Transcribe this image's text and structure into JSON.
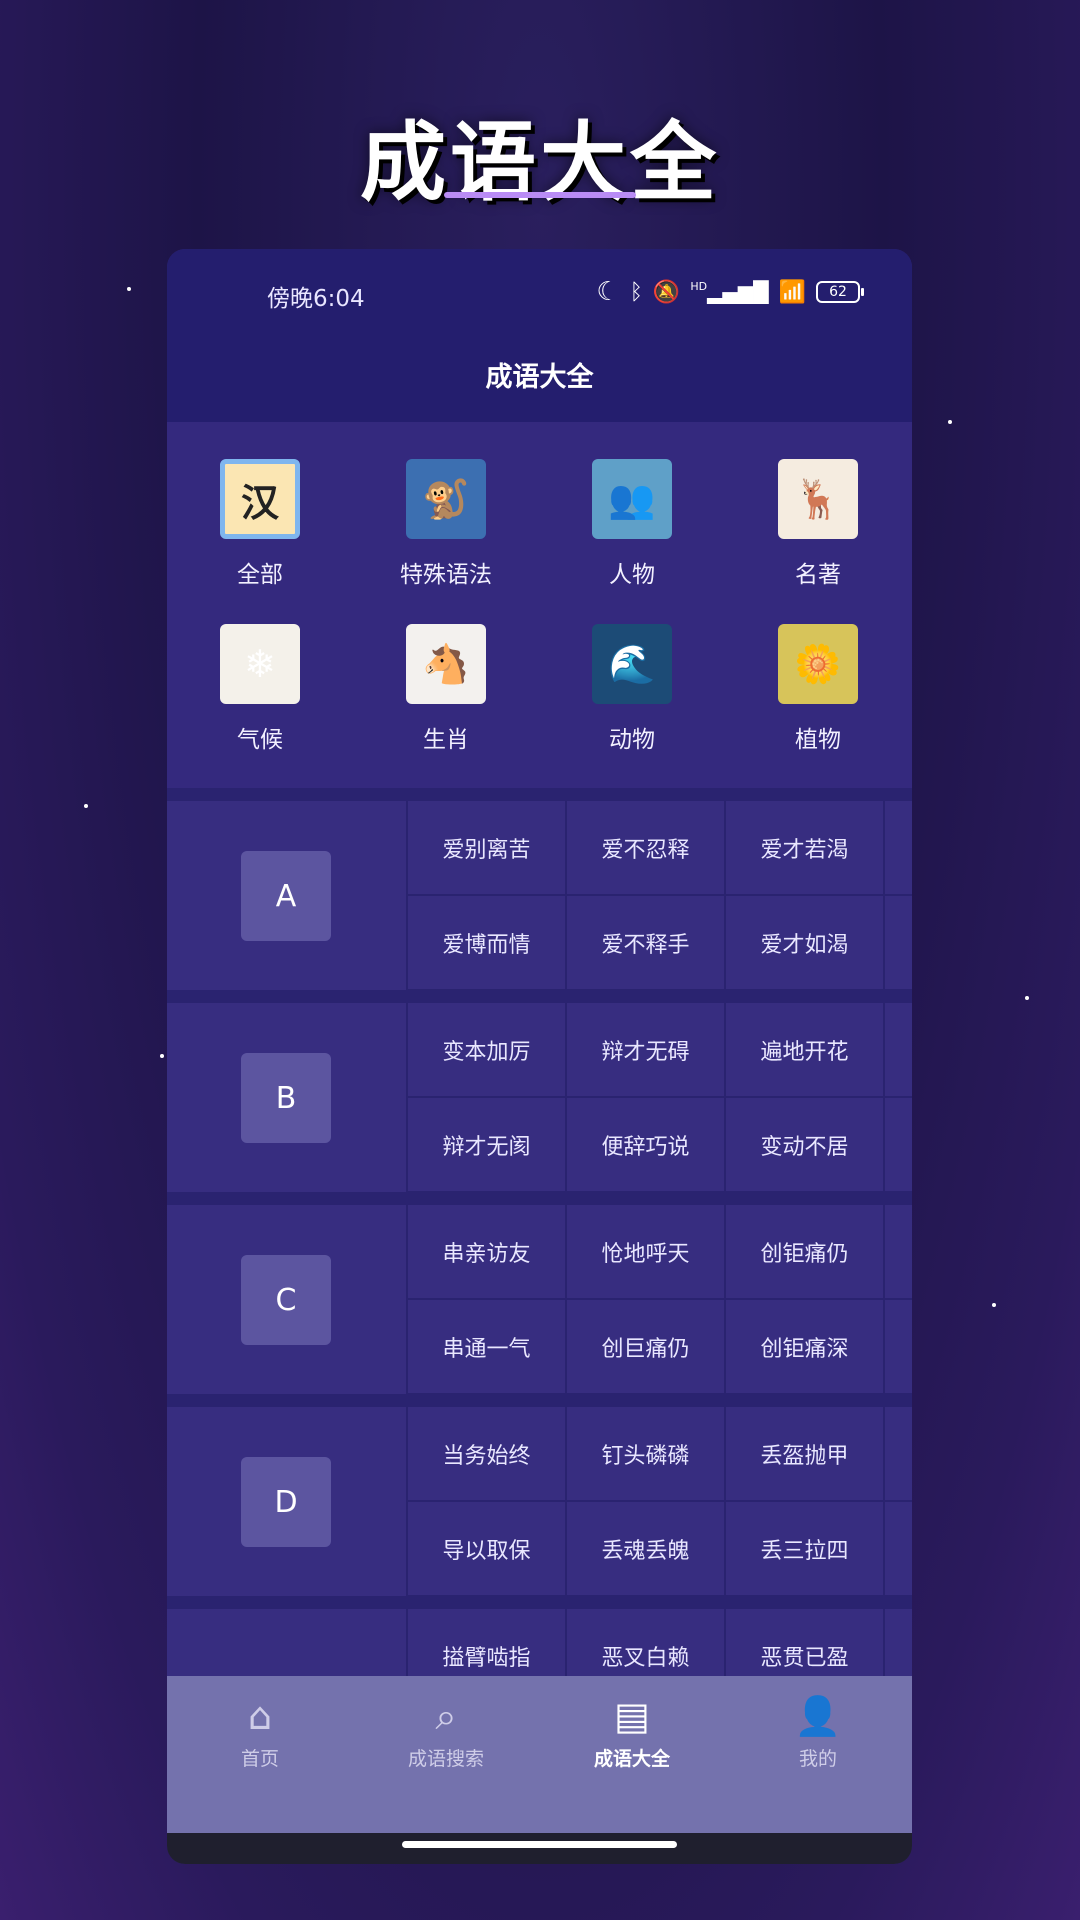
{
  "promo": {
    "title": "成语大全"
  },
  "status": {
    "time": "傍晚6:04",
    "battery": "62",
    "hd_label": "HD"
  },
  "app": {
    "title": "成语大全"
  },
  "categories": [
    {
      "label": "全部",
      "icon": "han-character-icon",
      "glyph": "汉",
      "bg": "#fbe6b3"
    },
    {
      "label": "特殊语法",
      "icon": "illustration-icon",
      "glyph": "🐒",
      "bg": "#3c6fb1"
    },
    {
      "label": "人物",
      "icon": "illustration-icon",
      "glyph": "👥",
      "bg": "#5fa0c8"
    },
    {
      "label": "名著",
      "icon": "illustration-icon",
      "glyph": "🦌",
      "bg": "#f5ece0"
    },
    {
      "label": "气候",
      "icon": "illustration-icon",
      "glyph": "❄",
      "bg": "#f4f1ea"
    },
    {
      "label": "生肖",
      "icon": "illustration-icon",
      "glyph": "🐴",
      "bg": "#f3f1ee"
    },
    {
      "label": "动物",
      "icon": "illustration-icon",
      "glyph": "🌊",
      "bg": "#1c4b76"
    },
    {
      "label": "植物",
      "icon": "illustration-icon",
      "glyph": "🌼",
      "bg": "#d7c45a"
    }
  ],
  "groups": [
    {
      "letter": "A",
      "idioms": [
        "爱别离苦",
        "爱不忍释",
        "爱才若渴",
        "爱博而情",
        "爱不释手",
        "爱才如渴"
      ]
    },
    {
      "letter": "B",
      "idioms": [
        "变本加厉",
        "辩才无碍",
        "遍地开花",
        "辩才无阂",
        "便辞巧说",
        "变动不居"
      ]
    },
    {
      "letter": "C",
      "idioms": [
        "串亲访友",
        "怆地呼天",
        "创钜痛仍",
        "串通一气",
        "创巨痛仍",
        "创钜痛深"
      ]
    },
    {
      "letter": "D",
      "idioms": [
        "当务始终",
        "钉头磷磷",
        "丢盔抛甲",
        "导以取保",
        "丢魂丢魄",
        "丢三拉四"
      ]
    },
    {
      "letter": "",
      "idioms": [
        "搤臂啮指",
        "恶叉白赖",
        "恶贯已盈"
      ]
    }
  ],
  "nav": [
    {
      "label": "首页",
      "icon": "home-icon",
      "glyph": "⌂"
    },
    {
      "label": "成语搜索",
      "icon": "search-icon",
      "glyph": "⌕"
    },
    {
      "label": "成语大全",
      "icon": "book-icon",
      "glyph": "▤"
    },
    {
      "label": "我的",
      "icon": "user-icon",
      "glyph": "👤"
    }
  ],
  "nav_active_index": 2
}
